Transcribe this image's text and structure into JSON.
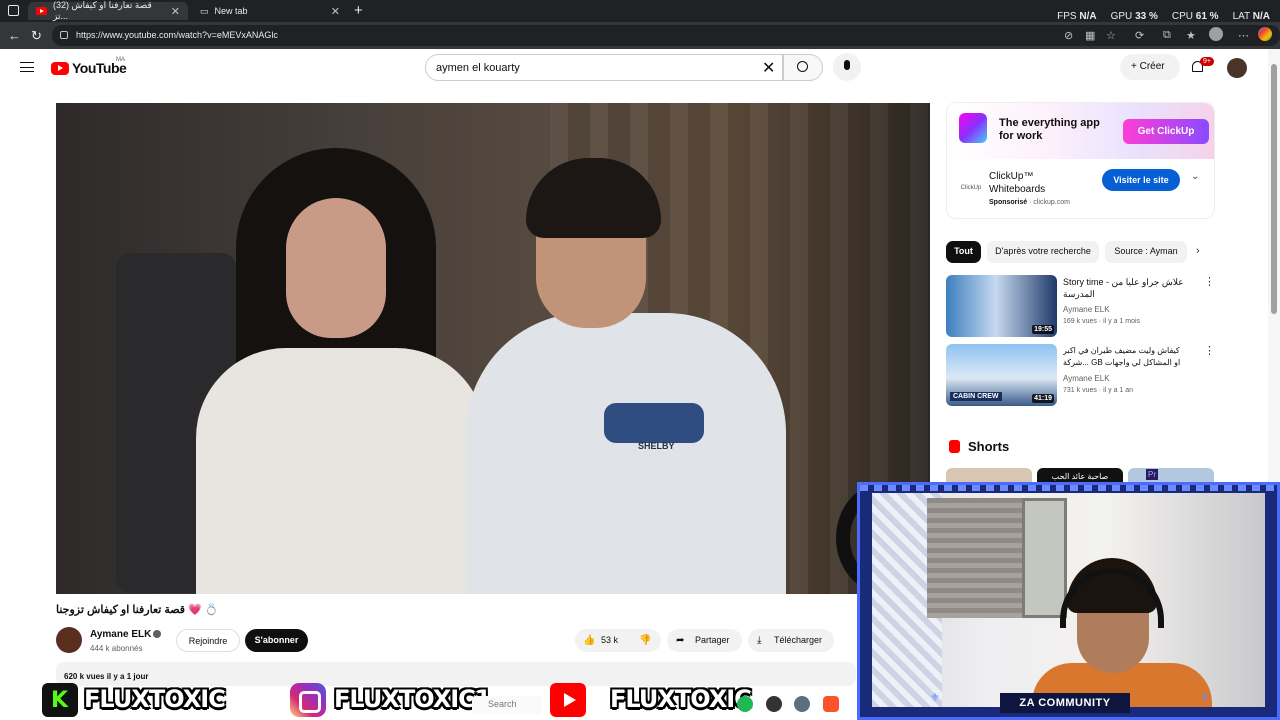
{
  "browser": {
    "tabs": [
      {
        "label": "(32) قصة تعارفنا او كيفاش تز...",
        "active": true
      },
      {
        "label": "New tab",
        "active": false
      }
    ],
    "url": "https://www.youtube.com/watch?v=eMEVxANAGlc",
    "perf": {
      "fps_label": "FPS",
      "fps": "N/A",
      "gpu_label": "GPU",
      "gpu": "33 %",
      "cpu_label": "CPU",
      "cpu": "61 %",
      "lat_label": "LAT",
      "lat": "N/A"
    }
  },
  "youtube": {
    "logo_text": "YouTube",
    "region": "MA",
    "search_value": "aymen el kouarty",
    "create_label": "Créer",
    "notif_badge": "9+"
  },
  "video": {
    "shirt_text": "SHELBY",
    "title": "قصة تعارفنا او كيفاش تزوجنا 💗 💍",
    "channel": "Aymane ELK",
    "subscribers": "444 k abonnés",
    "join_label": "Rejoindre",
    "subscribe_label": "S'abonner",
    "likes": "53 k",
    "share_label": "Partager",
    "download_label": "Télécharger",
    "meta": "620 k vues  il y a 1 jour"
  },
  "ad": {
    "headline": "The everything app for work",
    "cta_top": "Get ClickUp",
    "icon_label": "ClickUp",
    "name": "ClickUp™ Whiteboards",
    "sponsored": "Sponsorisé",
    "domain": "· clickup.com",
    "cta_bottom": "Visiter le site"
  },
  "chips": [
    "Tout",
    "D'après votre recherche",
    "Source : Ayman"
  ],
  "recommendations": [
    {
      "title": "Story time - علاش جراو عليا من المدرسة",
      "channel": "Aymane ELK",
      "stats": "169 k vues · il y a 1 mois",
      "duration": "19:55"
    },
    {
      "title": "كيفاش وليت مضيف طيران في اكبر شركة... GB او المشاكل لي واجهات جوجينا او شفت مع",
      "channel": "Aymane ELK",
      "stats": "731 k vues · il y a 1 an",
      "duration": "41:19",
      "overlay": "CABIN CREW"
    }
  ],
  "shorts_label": "Shorts",
  "short_peek_text": "صاحبة عائد الحب",
  "short_badge": "Pr",
  "overlay": {
    "caption": "ZA COMMUNITY",
    "kick_handle": "FLUXTOXIC",
    "insta_handle": "FLUXTOXIC1",
    "yt_handle": "FLUXTOXIC",
    "taskbar_search": "Search"
  }
}
